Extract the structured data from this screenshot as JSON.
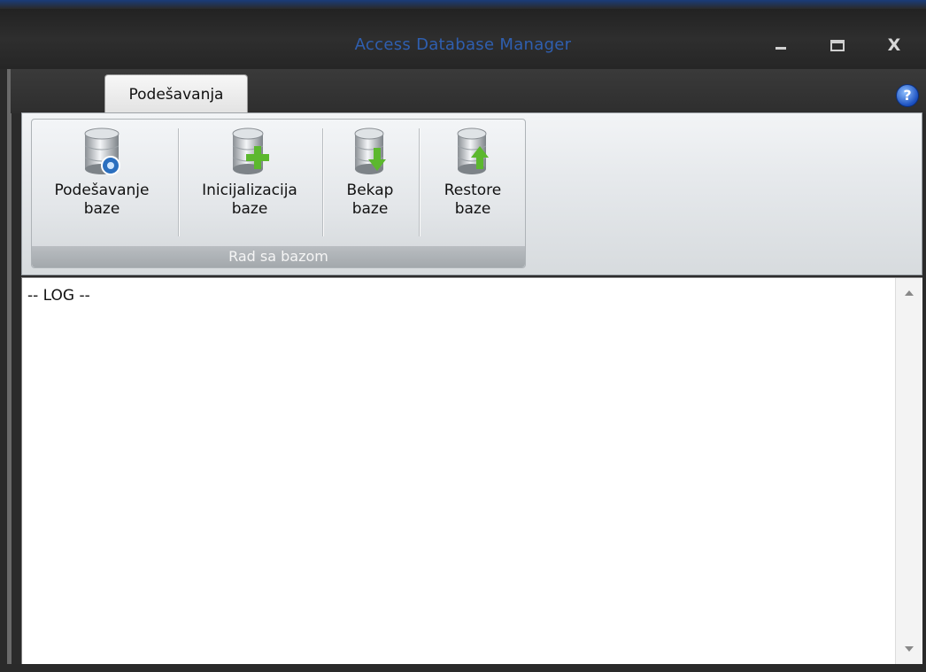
{
  "window": {
    "title": "Access Database Manager",
    "controls": {
      "minimize": "–",
      "maximize": "□",
      "close": "X"
    }
  },
  "tabs": [
    {
      "label": "Podešavanja",
      "selected": true
    }
  ],
  "help_label": "?",
  "ribbon": {
    "group_label": "Rad sa bazom",
    "buttons": [
      {
        "line1": "Podešavanje",
        "line2": "baze",
        "icon": "database-settings-icon"
      },
      {
        "line1": "Inicijalizacija",
        "line2": "baze",
        "icon": "database-add-icon"
      },
      {
        "line1": "Bekap",
        "line2": "baze",
        "icon": "database-backup-icon"
      },
      {
        "line1": "Restore",
        "line2": "baze",
        "icon": "database-restore-icon"
      }
    ]
  },
  "log": {
    "text": "-- LOG --"
  },
  "colors": {
    "title_text": "#2f5fb0",
    "chrome_dark": "#2b2b2b",
    "accent_green": "#5cb82e",
    "help_blue": "#1a4fbf"
  }
}
